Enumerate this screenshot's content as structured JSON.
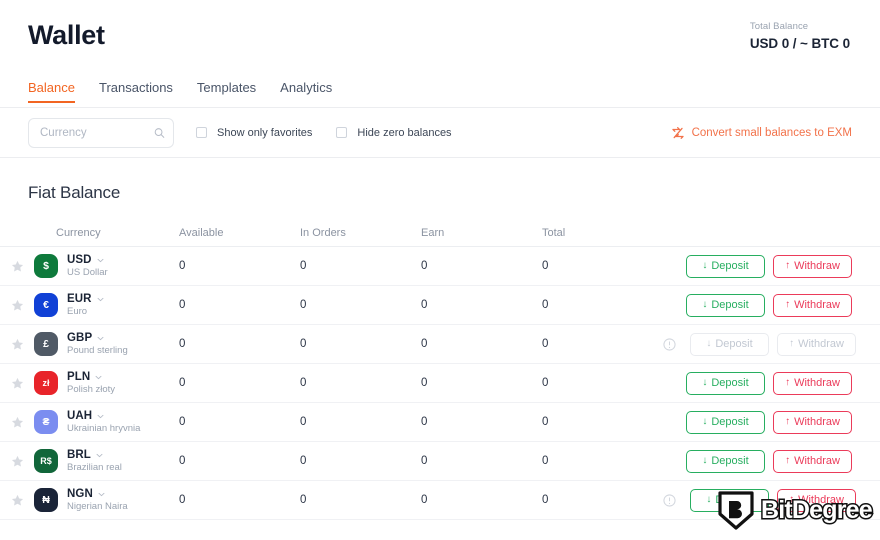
{
  "header": {
    "title": "Wallet",
    "total_balance_label": "Total Balance",
    "total_balance_value": "USD 0 / ~ BTC 0"
  },
  "tabs": [
    {
      "label": "Balance",
      "active": true
    },
    {
      "label": "Transactions",
      "active": false
    },
    {
      "label": "Templates",
      "active": false
    },
    {
      "label": "Analytics",
      "active": false
    }
  ],
  "filters": {
    "search_placeholder": "Currency",
    "search_value": "",
    "search_icon": "search-icon",
    "checkboxes": [
      {
        "label": "Show only favorites",
        "checked": false
      },
      {
        "label": "Hide zero balances",
        "checked": false
      }
    ],
    "convert": {
      "label": "Convert small balances to EXM",
      "icon": "swap-icon",
      "color": "#f2724a"
    }
  },
  "section": {
    "title": "Fiat Balance"
  },
  "table": {
    "columns": [
      "Currency",
      "Available",
      "In Orders",
      "Earn",
      "Total"
    ],
    "deposit_label": "Deposit",
    "withdraw_label": "Withdraw",
    "deposit_arrow": "↓",
    "withdraw_arrow": "↑",
    "rows": [
      {
        "code": "USD",
        "name": "US Dollar",
        "symbol": "$",
        "color": "#0e7a3c",
        "available": "0",
        "in_orders": "0",
        "earn": "0",
        "total": "0",
        "favorite": false,
        "disabled": false,
        "info": false
      },
      {
        "code": "EUR",
        "name": "Euro",
        "symbol": "€",
        "color": "#1141d6",
        "available": "0",
        "in_orders": "0",
        "earn": "0",
        "total": "0",
        "favorite": false,
        "disabled": false,
        "info": false
      },
      {
        "code": "GBP",
        "name": "Pound sterling",
        "symbol": "£",
        "color": "#505a66",
        "available": "0",
        "in_orders": "0",
        "earn": "0",
        "total": "0",
        "favorite": false,
        "disabled": true,
        "info": true
      },
      {
        "code": "PLN",
        "name": "Polish złoty",
        "symbol": "zł",
        "color": "#e8242a",
        "available": "0",
        "in_orders": "0",
        "earn": "0",
        "total": "0",
        "favorite": false,
        "disabled": false,
        "info": false
      },
      {
        "code": "UAH",
        "name": "Ukrainian hryvnia",
        "symbol": "₴",
        "color": "#7b8df0",
        "available": "0",
        "in_orders": "0",
        "earn": "0",
        "total": "0",
        "favorite": false,
        "disabled": false,
        "info": false
      },
      {
        "code": "BRL",
        "name": "Brazilian real",
        "symbol": "R$",
        "color": "#11663a",
        "available": "0",
        "in_orders": "0",
        "earn": "0",
        "total": "0",
        "favorite": false,
        "disabled": false,
        "info": false
      },
      {
        "code": "NGN",
        "name": "Nigerian Naira",
        "symbol": "₦",
        "color": "#1a2438",
        "available": "0",
        "in_orders": "0",
        "earn": "0",
        "total": "0",
        "favorite": false,
        "disabled": false,
        "info": true
      }
    ]
  },
  "watermark": {
    "text": "BitDegree",
    "mark": "B"
  }
}
